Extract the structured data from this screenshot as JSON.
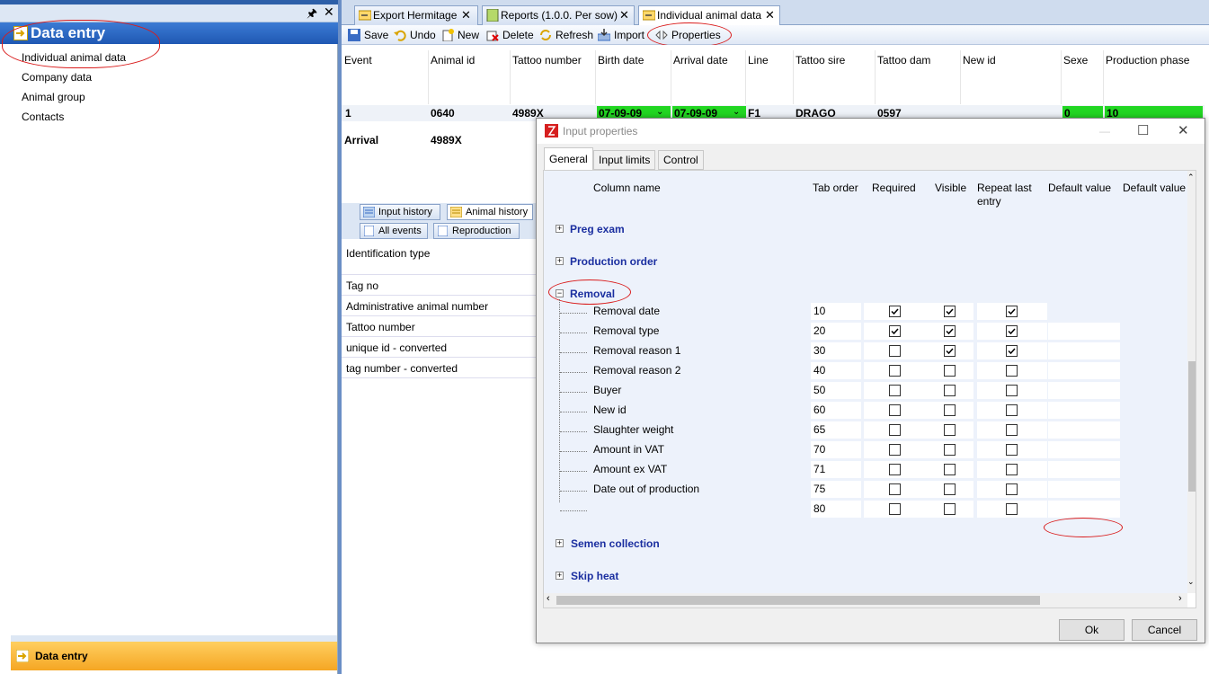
{
  "left_panel": {
    "header_title": "Data entry",
    "nav_items": [
      "Individual animal data",
      "Company data",
      "Animal group",
      "Contacts"
    ],
    "footer_title": "Data entry",
    "pin_icon": "pin-icon",
    "close_icon": "close-icon"
  },
  "doc_tabs": [
    {
      "label": "Export Hermitage"
    },
    {
      "label": "Reports (1.0.0. Per sow)"
    },
    {
      "label": "Individual animal data"
    }
  ],
  "toolbar": {
    "save": "Save",
    "undo": "Undo",
    "new": "New",
    "delete": "Delete",
    "refresh": "Refresh",
    "import": "Import",
    "properties": "Properties"
  },
  "grid": {
    "columns": [
      "Event",
      "Animal id",
      "Tattoo number",
      "Birth date",
      "Arrival date",
      "Line",
      "Tattoo sire",
      "Tattoo dam",
      "New id",
      "Sexe",
      "Production phase"
    ],
    "row1": {
      "event": "1",
      "animal_id": "0640",
      "tattoo": "4989X",
      "birth": "07-09-09",
      "arrival": "07-09-09",
      "line": "F1",
      "sire": "DRAGO",
      "dam": "0597",
      "new_id": "",
      "sexe": "0",
      "phase": "10"
    },
    "row2": {
      "event": "Arrival",
      "animal_id": "4989X"
    }
  },
  "lower_tabs": {
    "top": [
      "Input history",
      "Animal history"
    ],
    "bottom": [
      "All events",
      "Reproduction"
    ]
  },
  "property_list": {
    "header": "Identification type",
    "items": [
      "Tag no",
      "Administrative animal number",
      "Tattoo number",
      "unique id - converted",
      "tag number - converted"
    ]
  },
  "dialog": {
    "title": "Input properties",
    "tabs": [
      "General",
      "Input limits",
      "Control"
    ],
    "columns": {
      "column_name": "Column name",
      "tab_order": "Tab order",
      "required": "Required",
      "visible": "Visible",
      "repeat_last_line1": "Repeat last",
      "repeat_last_line2": "entry",
      "default_value_1": "Default value",
      "default_value_2": "Default value"
    },
    "groups_before": [
      "Preg exam",
      "Production order"
    ],
    "expanded_group": "Removal",
    "groups_after": [
      "Semen collection",
      "Skip heat"
    ],
    "fields": [
      {
        "name": "Removal date",
        "tab": "10",
        "required": true,
        "visible": true,
        "repeat": true
      },
      {
        "name": "Removal type",
        "tab": "20",
        "required": true,
        "visible": true,
        "repeat": true
      },
      {
        "name": "Removal reason 1",
        "tab": "30",
        "required": false,
        "visible": true,
        "repeat": true
      },
      {
        "name": "Removal reason 2",
        "tab": "40",
        "required": false,
        "visible": false,
        "repeat": false
      },
      {
        "name": "Buyer",
        "tab": "50",
        "required": false,
        "visible": false,
        "repeat": false
      },
      {
        "name": "New id",
        "tab": "60",
        "required": false,
        "visible": false,
        "repeat": false
      },
      {
        "name": "Slaughter weight",
        "tab": "65",
        "required": false,
        "visible": false,
        "repeat": false
      },
      {
        "name": "Amount in VAT",
        "tab": "70",
        "required": false,
        "visible": false,
        "repeat": false
      },
      {
        "name": "Amount ex VAT",
        "tab": "71",
        "required": false,
        "visible": false,
        "repeat": false
      },
      {
        "name": "Date out of production",
        "tab": "75",
        "required": false,
        "visible": false,
        "repeat": false
      },
      {
        "name": "",
        "tab": "80",
        "required": false,
        "visible": false,
        "repeat": false
      }
    ],
    "ok": "Ok",
    "cancel": "Cancel"
  },
  "colors": {
    "header_blue": "#2d5fa8",
    "footer_orange": "#f5a623",
    "green_cell": "#22d622",
    "group_blue": "#1b2fa0",
    "annotation_red": "#d91b1b"
  }
}
